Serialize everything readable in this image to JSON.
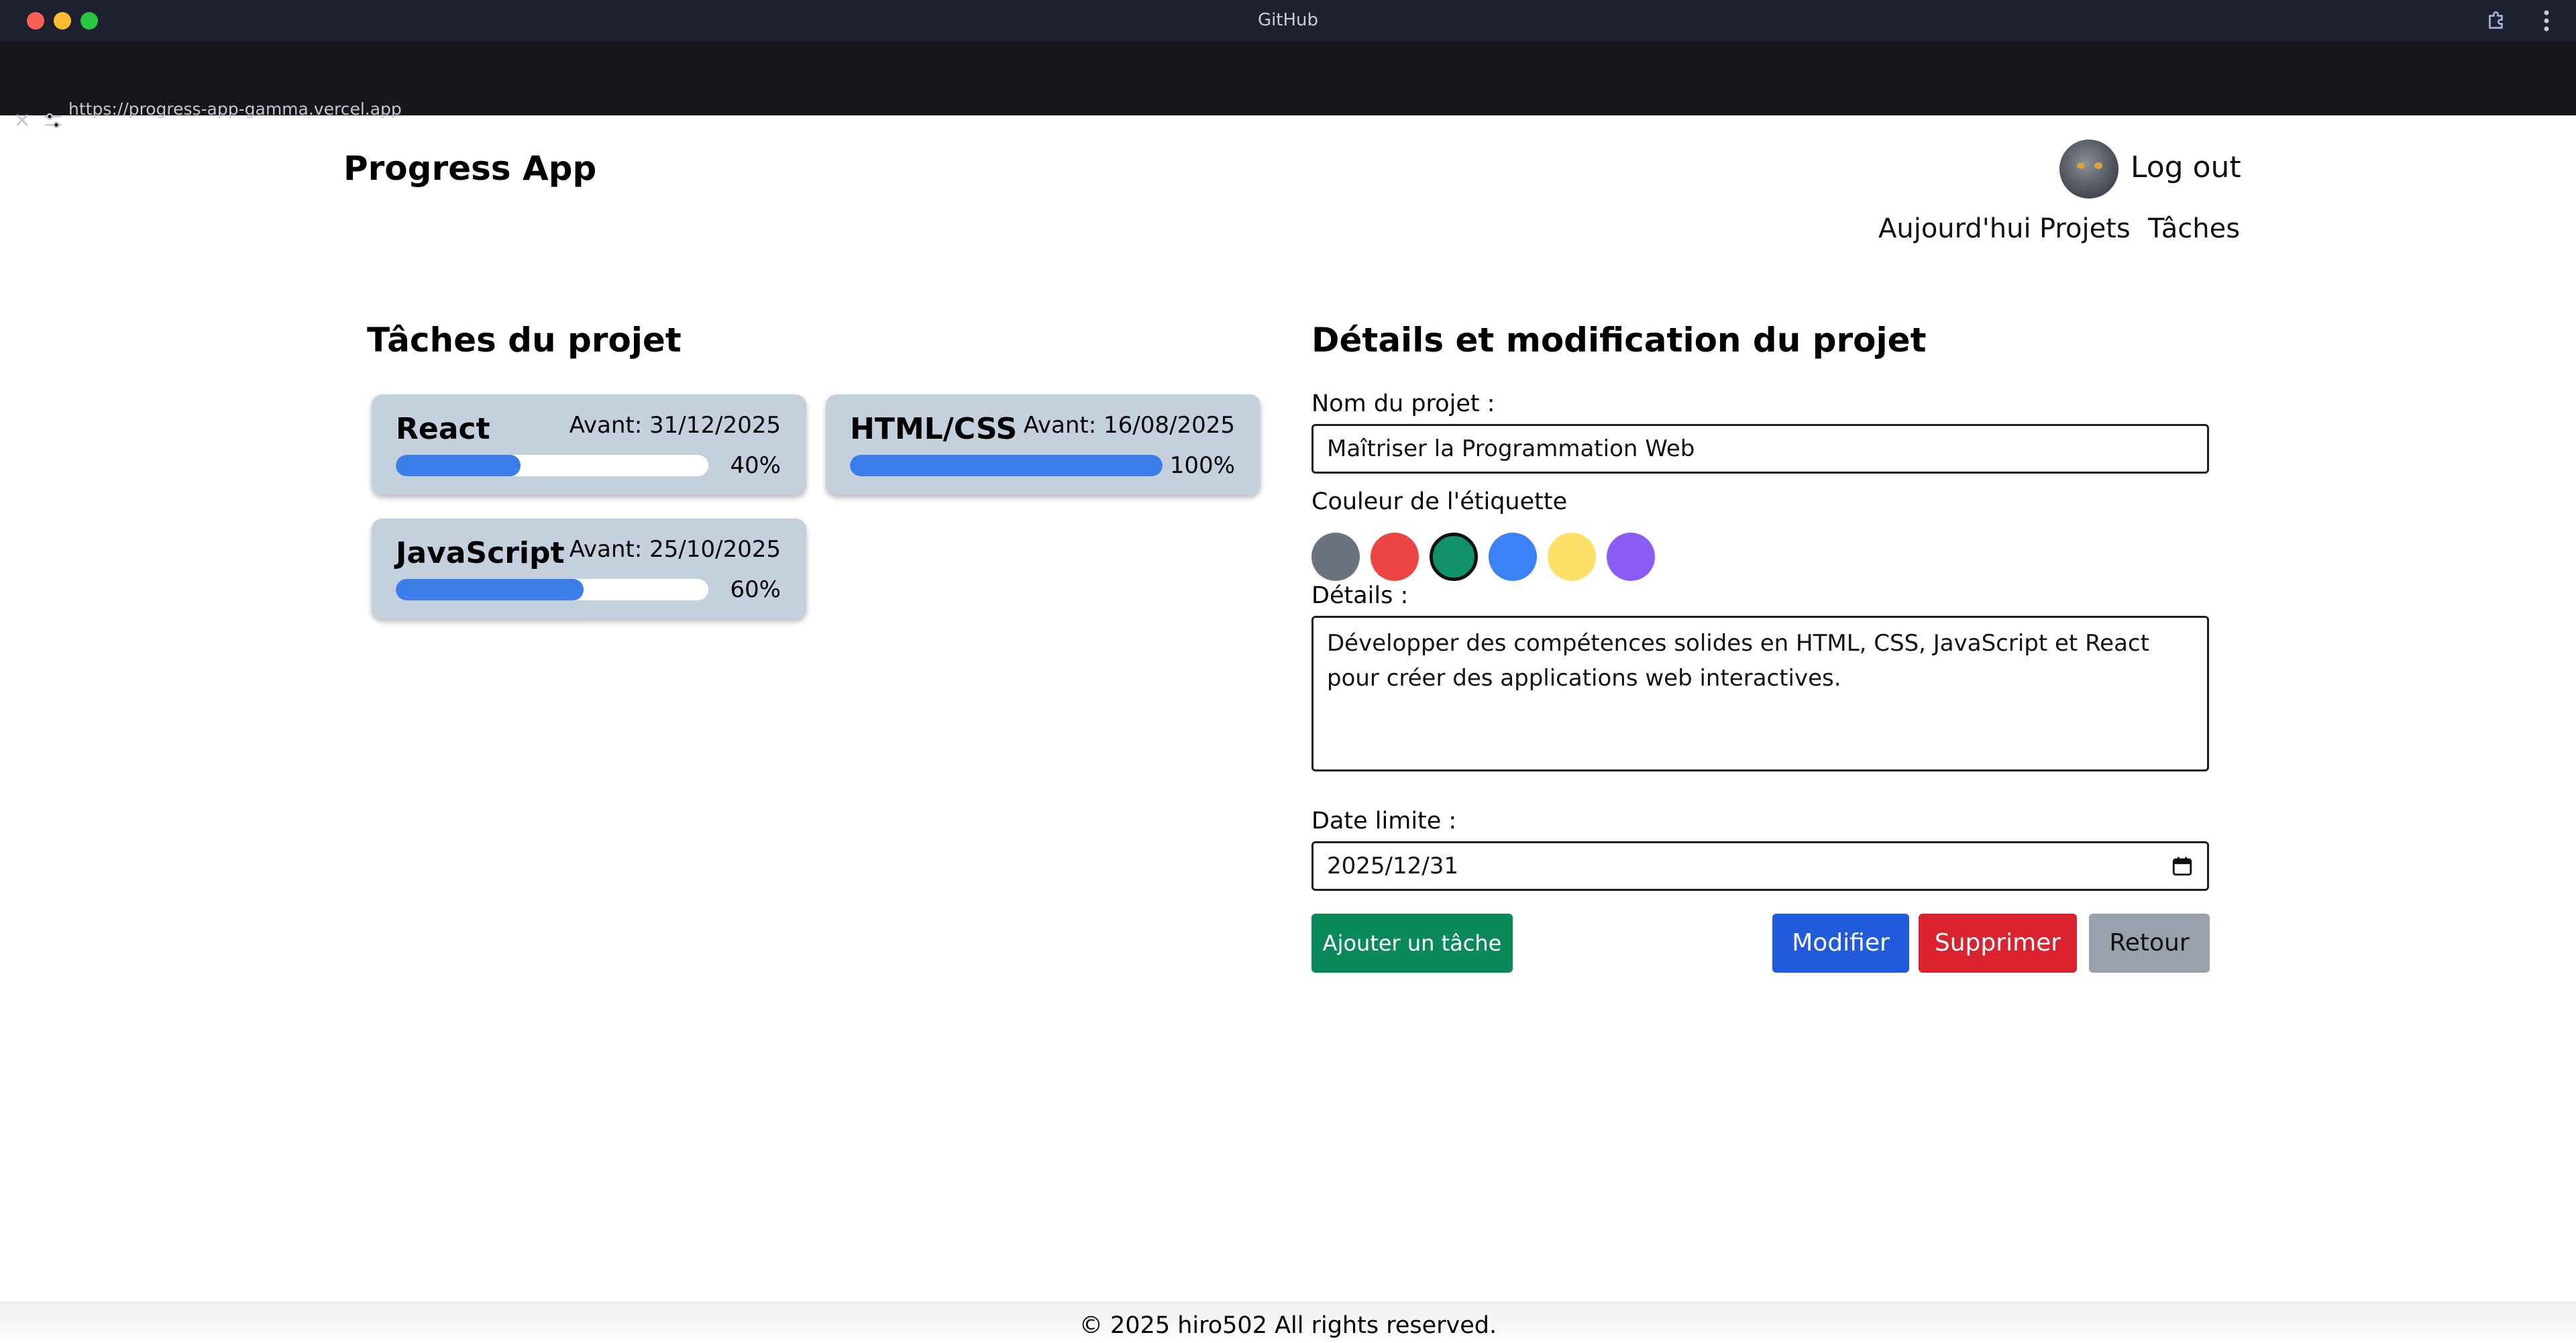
{
  "browser": {
    "window_title": "GitHub",
    "url": "https://progress-app-gamma.vercel.app",
    "page_title": "Progress App",
    "icons": [
      "close-icon",
      "tune-icon",
      "extension-icon",
      "more-vert-icon",
      "calendar-icon"
    ]
  },
  "header": {
    "app_title": "Progress App",
    "logout_label": "Log out",
    "nav": [
      "Aujourd'hui",
      "Projets",
      "Tâches"
    ]
  },
  "tasks_panel": {
    "title": "Tâches du projet",
    "tasks": [
      {
        "name": "React",
        "due": "Avant: 31/12/2025",
        "progress": 40,
        "progress_label": "40%"
      },
      {
        "name": "HTML/CSS",
        "due": "Avant: 16/08/2025",
        "progress": 100,
        "progress_label": "100%"
      },
      {
        "name": "JavaScript",
        "due": "Avant: 25/10/2025",
        "progress": 60,
        "progress_label": "60%"
      }
    ]
  },
  "details_panel": {
    "title": "Détails et modification du projet",
    "name_label": "Nom du projet :",
    "name_value": "Maîtriser la Programmation Web",
    "color_label": "Couleur de l'étiquette",
    "colors": [
      "#6b7280",
      "#ef4444",
      "#10916a",
      "#3b82f6",
      "#fde068",
      "#8b5cf6"
    ],
    "selected_color_index": 2,
    "details_label": "Détails :",
    "details_value": "Développer des compétences solides en HTML, CSS, JavaScript et React pour créer des applications web interactives.",
    "date_label": "Date limite :",
    "date_value": "2025/12/31",
    "buttons": {
      "add": "Ajouter un tâche",
      "modify": "Modifier",
      "delete": "Supprimer",
      "back": "Retour"
    }
  },
  "footer": {
    "text": "© 2025 hiro502 All rights reserved."
  }
}
